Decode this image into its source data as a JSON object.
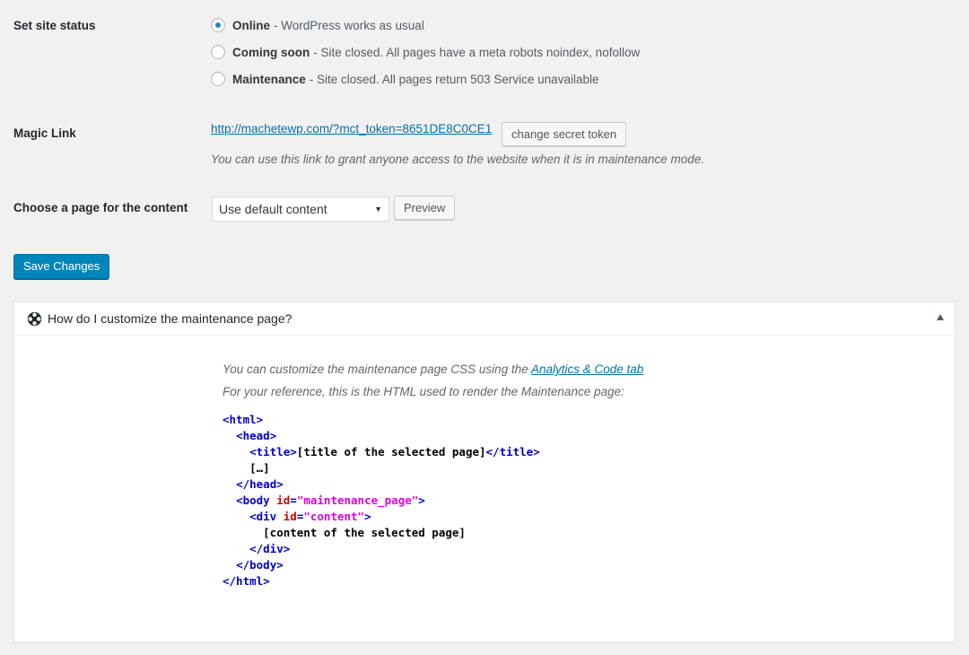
{
  "site_status": {
    "label": "Set site status",
    "options": [
      {
        "name": "Online",
        "description": "- WordPress works as usual",
        "checked": true
      },
      {
        "name": "Coming soon",
        "description": "- Site closed. All pages have a meta robots noindex, nofollow",
        "checked": false
      },
      {
        "name": "Maintenance",
        "description": "- Site closed. All pages return 503 Service unavailable",
        "checked": false
      }
    ]
  },
  "magic_link": {
    "label": "Magic Link",
    "url": "http://machetewp.com/?mct_token=8651DE8C0CE1",
    "change_button": "change secret token",
    "description": "You can use this link to grant anyone access to the website when it is in maintenance mode."
  },
  "content_page": {
    "label": "Choose a page for the content",
    "selected": "Use default content",
    "preview_button": "Preview"
  },
  "save_button": "Save Changes",
  "help_panel": {
    "title": "How do I customize the maintenance page?",
    "line1_prefix": "You can customize the maintenance page CSS using the",
    "line1_link": "Analytics & Code tab",
    "line2": "For your reference, this is the HTML used to render the Maintenance page:",
    "code": {
      "html_open": "<html>",
      "head_open": "<head>",
      "title_open": "<title>",
      "title_text": "[title of the selected page]",
      "title_close": "</title>",
      "ellipsis": "[…]",
      "head_close": "</head>",
      "body_open_start": "<body",
      "body_attr": "id",
      "body_eq": "=",
      "body_val": "\"maintenance_page\"",
      "body_open_end": ">",
      "div_open_start": "<div",
      "div_attr": "id",
      "div_eq": "=",
      "div_val": "\"content\"",
      "div_open_end": ">",
      "content_text": "[content of the selected page]",
      "div_close": "</div>",
      "body_close": "</body>",
      "html_close": "</html>"
    }
  }
}
